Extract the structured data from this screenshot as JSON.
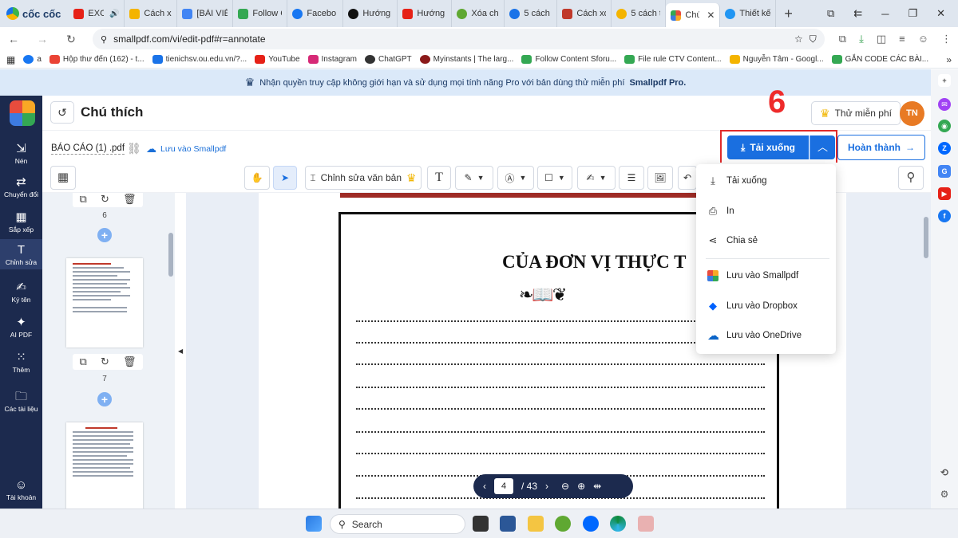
{
  "browser": {
    "brand": "cốc cốc",
    "tabs": [
      {
        "label": "EXO",
        "color": "#e62117"
      },
      {
        "label": "Cách xó",
        "color": "#f4b400"
      },
      {
        "label": "[BÀI VIẾ",
        "color": "#4285f4"
      },
      {
        "label": "Follow C",
        "color": "#34a853"
      },
      {
        "label": "Facebo",
        "color": "#1877f2"
      },
      {
        "label": "Hướng",
        "color": "#111111"
      },
      {
        "label": "Hướng",
        "color": "#e62117"
      },
      {
        "label": "Xóa chữ",
        "color": "#5fa832"
      },
      {
        "label": "5 cách x",
        "color": "#1a73e8"
      },
      {
        "label": "Cách xó",
        "color": "#c0392b"
      },
      {
        "label": "5 cách t",
        "color": "#f4b400"
      },
      {
        "label": "Chú",
        "color": "#f9a825",
        "active": true,
        "close": "✕"
      },
      {
        "label": "Thiết kế",
        "color": "#2196f3"
      }
    ],
    "new_tab": "+",
    "window_controls": [
      "⧉",
      "⇇",
      "─",
      "❐",
      "✕"
    ],
    "url": "smallpdf.com/vi/edit-pdf#r=annotate",
    "bookmarks": [
      {
        "label": "a",
        "color": "#1877f2"
      },
      {
        "label": "Hộp thư đến (162) - t...",
        "color": "#ea4335"
      },
      {
        "label": "tienichsv.ou.edu.vn/?...",
        "color": "#1a73e8"
      },
      {
        "label": "YouTube",
        "color": "#e62117"
      },
      {
        "label": "Instagram",
        "color": "#d62976"
      },
      {
        "label": "ChatGPT",
        "color": "#333333"
      },
      {
        "label": "Myinstants | The larg...",
        "color": "#8b1a1a"
      },
      {
        "label": "Follow Content Sforu...",
        "color": "#34a853"
      },
      {
        "label": "File rule CTV Content...",
        "color": "#34a853"
      },
      {
        "label": "Nguyễn Tâm - Googl...",
        "color": "#f4b400"
      },
      {
        "label": "GẮN CODE CÁC BÀI...",
        "color": "#34a853"
      }
    ]
  },
  "promo": {
    "text": "Nhận quyền truy cập không giới hạn và sử dụng mọi tính năng Pro với bản dùng thử miễn phí",
    "highlight": "Smallpdf Pro."
  },
  "rail": {
    "items": [
      {
        "label": "Nén",
        "icon": "⇲"
      },
      {
        "label": "Chuyển đổi",
        "icon": "⇄"
      },
      {
        "label": "Sắp xếp",
        "icon": "▦"
      },
      {
        "label": "Chỉnh sửa",
        "icon": "T",
        "active": true
      },
      {
        "label": "Ký tên",
        "icon": "✍"
      },
      {
        "label": "AI PDF",
        "icon": "✦"
      },
      {
        "label": "Thêm",
        "icon": "⁙"
      },
      {
        "label": "Các tài liệu",
        "icon": "🗀"
      },
      {
        "label": "Tài khoản",
        "icon": "☺"
      }
    ]
  },
  "header": {
    "back": "↺",
    "title": "Chú thích",
    "step_number": "6",
    "try_free": "Thử miễn phí",
    "avatar_initials": "TN"
  },
  "filebar": {
    "filename": "BÁO CÁO (1) .pdf",
    "save_cloud": "Lưu vào Smallpdf",
    "download_label": "Tải xuống",
    "finish_label": "Hoàn thành"
  },
  "toolbar": {
    "edit_text_label": "Chỉnh sửa văn bản"
  },
  "thumbnails": {
    "pages": [
      "6",
      "7"
    ]
  },
  "document": {
    "heading": "CỦA ĐƠN VỊ THỰC T",
    "ornament": "❧📖❦"
  },
  "pagenav": {
    "current": "4",
    "total": "/ 43"
  },
  "dropdown": {
    "items": [
      {
        "label": "Tải xuống",
        "icon": "⤓"
      },
      {
        "label": "In",
        "icon": "⎙"
      },
      {
        "label": "Chia sẻ",
        "icon": "⋖"
      },
      {
        "label": "Lưu vào Smallpdf",
        "icon": "▦"
      },
      {
        "label": "Lưu vào Dropbox",
        "icon": "◆"
      },
      {
        "label": "Lưu vào OneDrive",
        "icon": "☁"
      }
    ]
  },
  "taskbar": {
    "search": "Search"
  },
  "colors": {
    "accent": "#1a6fe0",
    "rail": "#1c2a4e",
    "highlight_frame": "#e02b2b",
    "step_number": "#ee2b2b"
  }
}
